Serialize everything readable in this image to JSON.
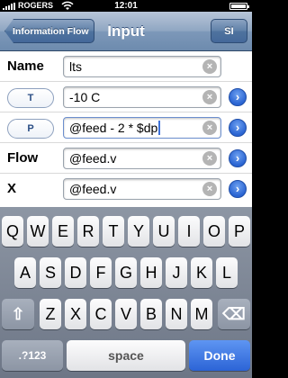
{
  "status_bar": {
    "carrier": "ROGERS",
    "time": "12:01"
  },
  "nav": {
    "back_label": "Information Flow",
    "title": "Input",
    "right_button": "SI"
  },
  "rows": [
    {
      "label": "Name",
      "value": "lts"
    },
    {
      "label": "T",
      "value": "-10 C"
    },
    {
      "label": "P",
      "value": "@feed - 2 * $dp"
    },
    {
      "label": "Flow",
      "value": "@feed.v"
    },
    {
      "label": "X",
      "value": "@feed.v"
    }
  ],
  "clear_glyph": "×",
  "disclosure_glyph": "›",
  "keyboard": {
    "row1": [
      "Q",
      "W",
      "E",
      "R",
      "T",
      "Y",
      "U",
      "I",
      "O",
      "P"
    ],
    "row2": [
      "A",
      "S",
      "D",
      "F",
      "G",
      "H",
      "J",
      "K",
      "L"
    ],
    "row3": [
      "Z",
      "X",
      "C",
      "V",
      "B",
      "N",
      "M"
    ],
    "shift": "⇧",
    "delete": "⌫",
    "numbers": ".?123",
    "space": "space",
    "done": "Done"
  },
  "colors": {
    "nav_blue": "#6d8bae",
    "done_blue": "#2c64d6",
    "accent_blue": "#2a64d2"
  }
}
